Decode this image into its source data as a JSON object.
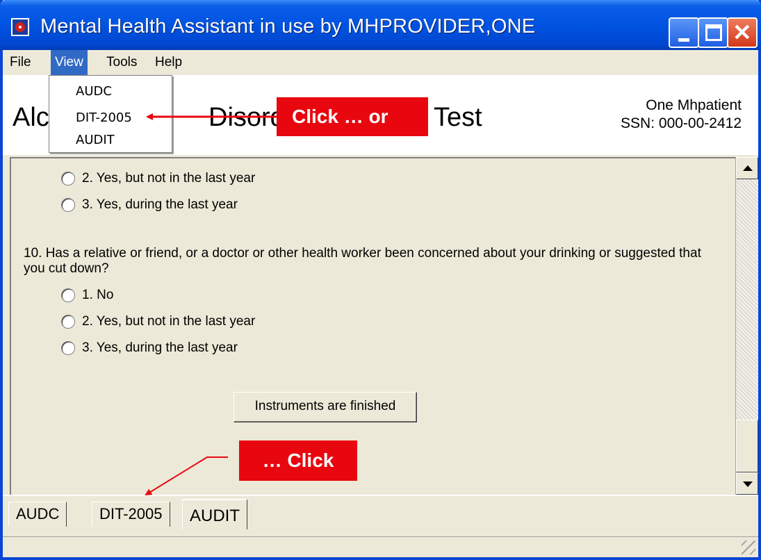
{
  "window": {
    "title": "Mental Health Assistant in use by MHPROVIDER,ONE",
    "accent_color": "#0053e1"
  },
  "menubar": {
    "items": [
      {
        "label": "File"
      },
      {
        "label": "View"
      },
      {
        "label": "Tools"
      },
      {
        "label": "Help"
      }
    ]
  },
  "view_menu": {
    "items": [
      "AUDC",
      "DIT-2005",
      "AUDIT"
    ]
  },
  "header": {
    "title_left": "Alc",
    "title_partial": "Disorders",
    "title_right": "Test",
    "patient_name": "One Mhpatient",
    "patient_ssn": "SSN: 000-00-2412"
  },
  "callouts": {
    "first": "Click … or",
    "second": "… Click",
    "color": "#e8070f"
  },
  "question9_options": [
    "2. Yes, but not in the last year",
    "3. Yes, during the last year"
  ],
  "question10": {
    "text": "10. Has a relative or friend, or a doctor or other health worker been concerned about your drinking or suggested that you cut down?",
    "options": [
      "1. No",
      "2. Yes, but not in the last year",
      "3. Yes, during the last year"
    ]
  },
  "finish_button": "Instruments are finished",
  "tabs": [
    "AUDC",
    "DIT-2005",
    "AUDIT"
  ],
  "active_tab": "AUDIT"
}
